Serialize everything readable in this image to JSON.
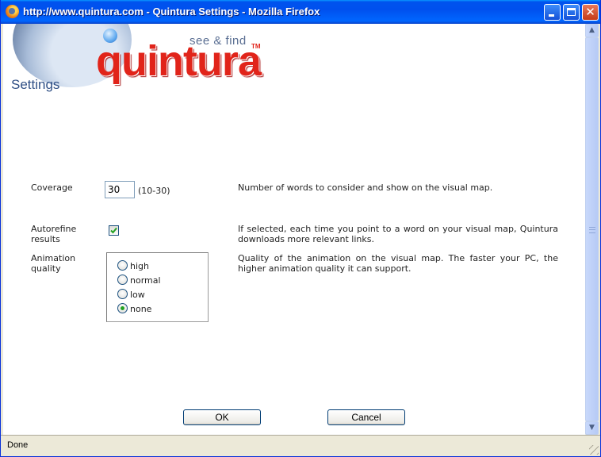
{
  "window": {
    "title": "http://www.quintura.com - Quintura Settings - Mozilla Firefox",
    "controls": {
      "minimize": "",
      "maximize": "",
      "close": "✕"
    }
  },
  "logo": {
    "tagline": "see & find",
    "word": "quintura",
    "tm": "TM"
  },
  "page_title": "Settings",
  "form": {
    "coverage": {
      "label": "Coverage",
      "value": "30",
      "hint": "(10-30)",
      "description": "Number of words to consider and show on the visual map."
    },
    "autorefine": {
      "label_line1": "Autorefine",
      "label_line2": "results",
      "checked": true,
      "description": "If selected, each time you point to a word on your visual map, Quintura downloads more relevant links."
    },
    "animation": {
      "label_line1": "Animation",
      "label_line2": "quality",
      "options": [
        {
          "label": "high",
          "selected": false
        },
        {
          "label": "normal",
          "selected": false
        },
        {
          "label": "low",
          "selected": false
        },
        {
          "label": "none",
          "selected": true
        }
      ],
      "description": "Quality of the animation on the visual map. The faster your PC, the higher animation quality it can support."
    }
  },
  "buttons": {
    "ok": "OK",
    "cancel": "Cancel"
  },
  "status": {
    "text": "Done"
  },
  "colors": {
    "accent_red": "#e1241a",
    "title_blue": "#2f4f85",
    "titlebar": "#0053ee"
  }
}
